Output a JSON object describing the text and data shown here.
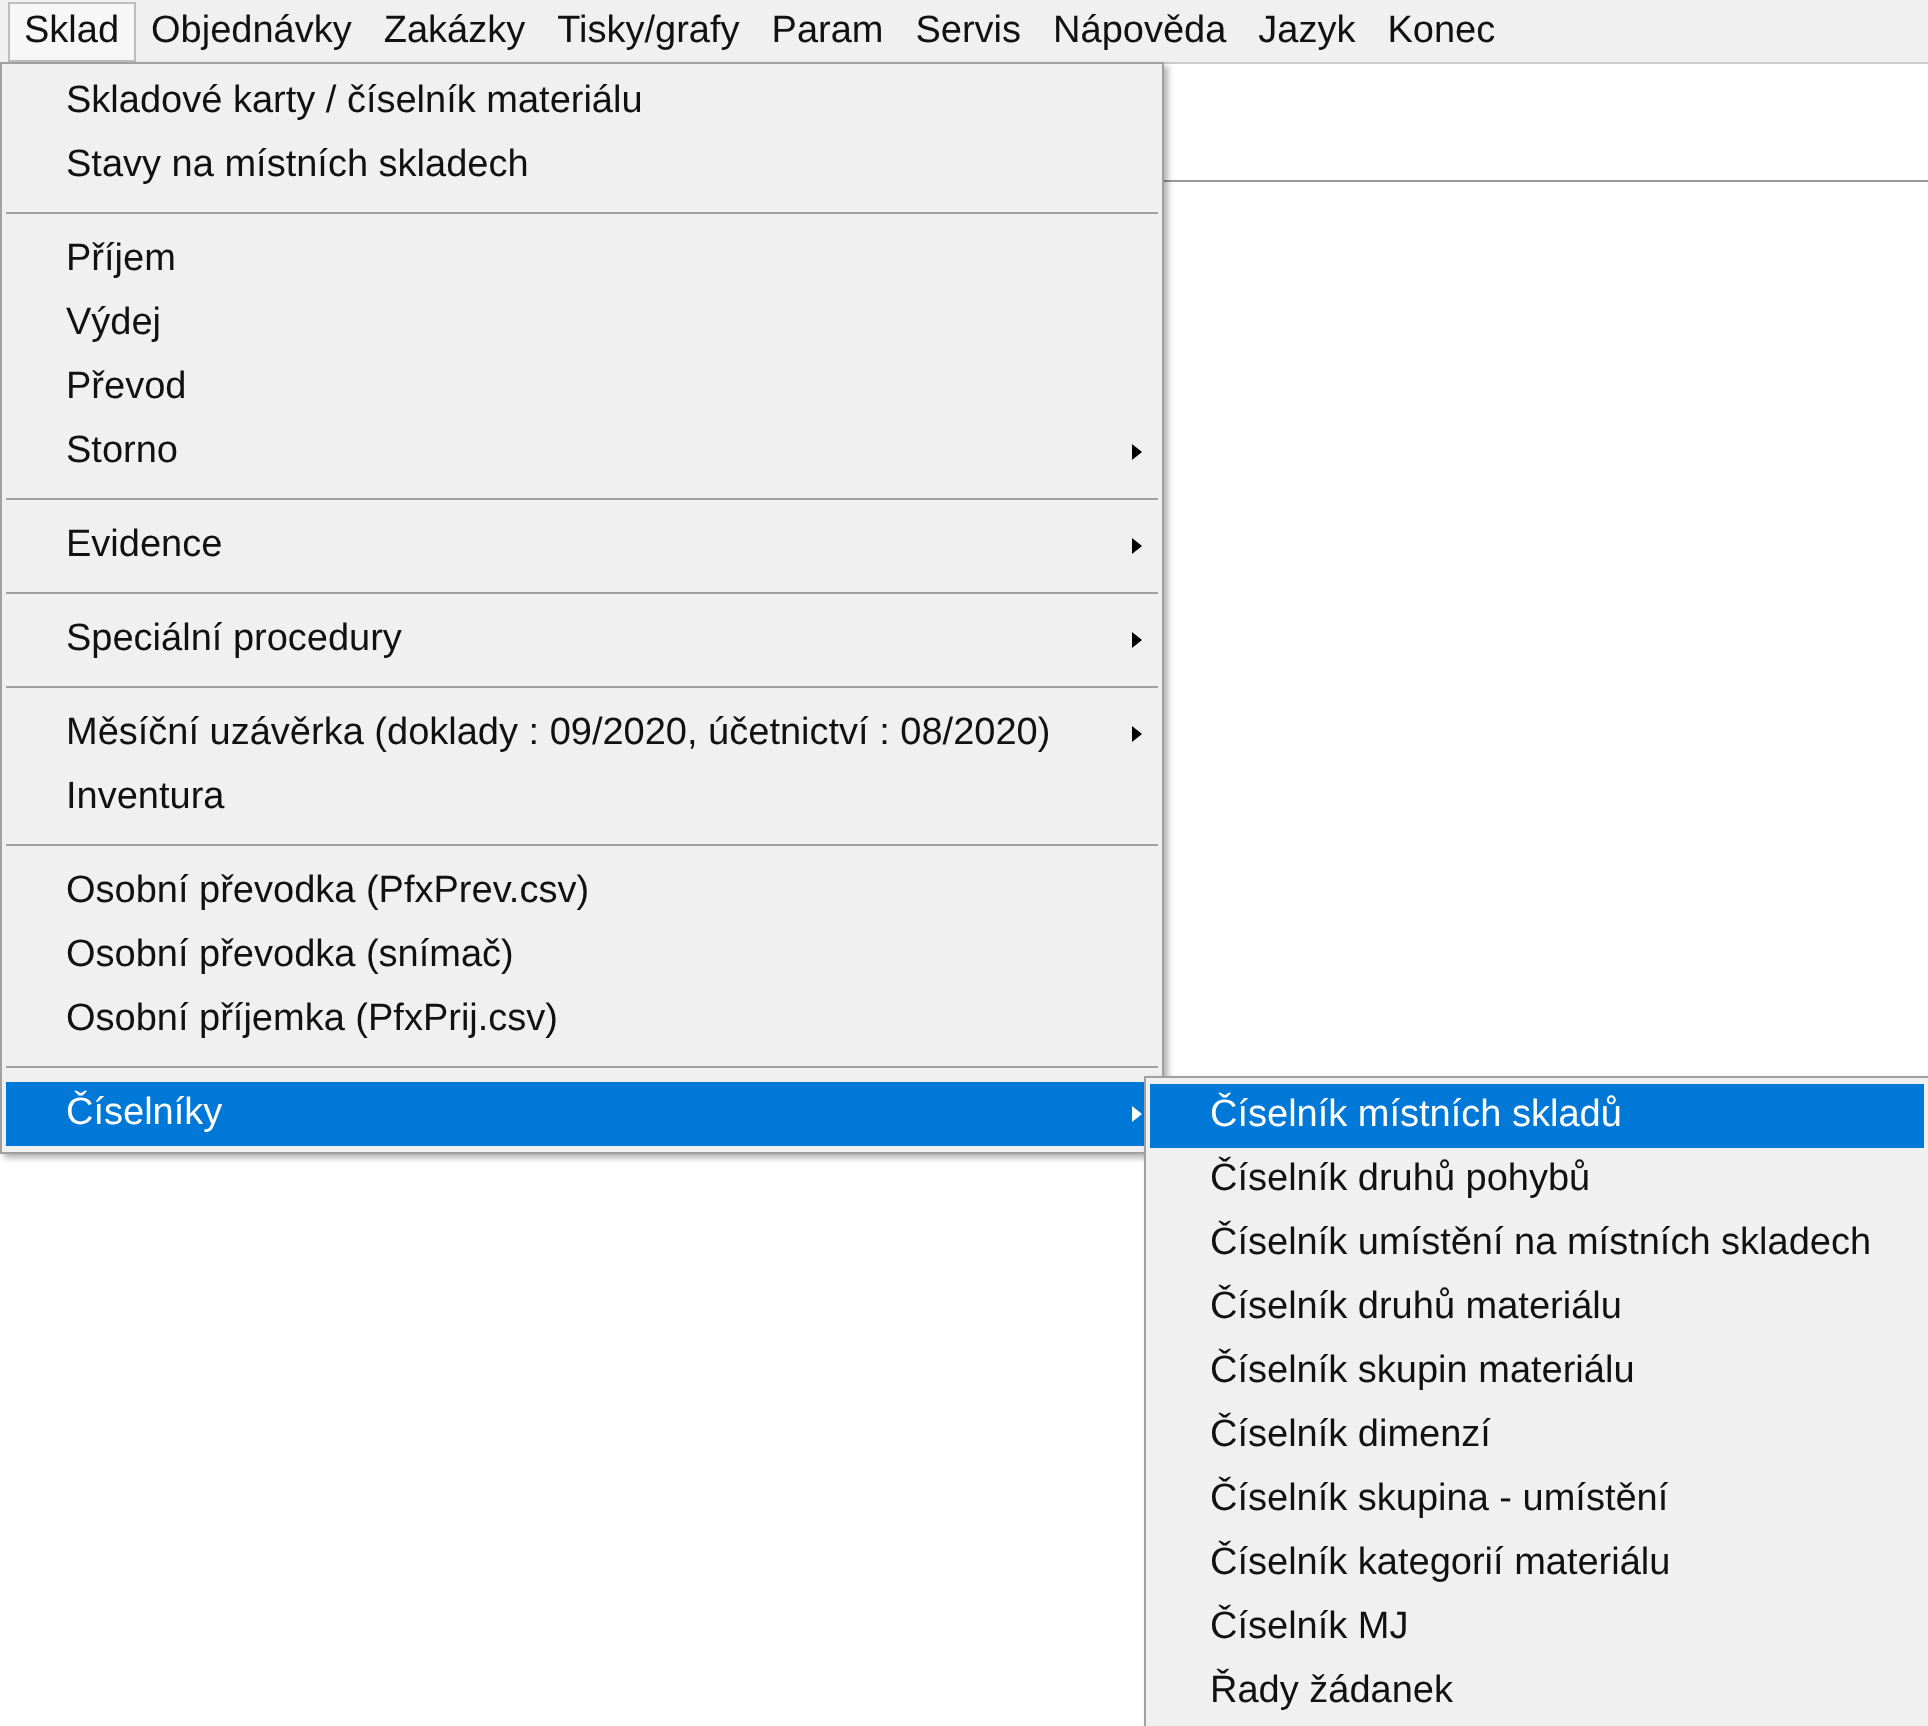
{
  "menubar": [
    {
      "label": "Sklad",
      "selected": true
    },
    {
      "label": "Objednávky",
      "selected": false
    },
    {
      "label": "Zakázky",
      "selected": false
    },
    {
      "label": "Tisky/grafy",
      "selected": false
    },
    {
      "label": "Param",
      "selected": false
    },
    {
      "label": "Servis",
      "selected": false
    },
    {
      "label": "Nápověda",
      "selected": false
    },
    {
      "label": "Jazyk",
      "selected": false
    },
    {
      "label": "Konec",
      "selected": false
    }
  ],
  "menu": [
    {
      "kind": "item",
      "label": "Skladové karty / číselník materiálu",
      "submenu": false,
      "selected": false
    },
    {
      "kind": "item",
      "label": "Stavy na místních skladech",
      "submenu": false,
      "selected": false
    },
    {
      "kind": "separator"
    },
    {
      "kind": "item",
      "label": "Příjem",
      "submenu": false,
      "selected": false
    },
    {
      "kind": "item",
      "label": "Výdej",
      "submenu": false,
      "selected": false
    },
    {
      "kind": "item",
      "label": "Převod",
      "submenu": false,
      "selected": false
    },
    {
      "kind": "item",
      "label": "Storno",
      "submenu": true,
      "selected": false
    },
    {
      "kind": "separator"
    },
    {
      "kind": "item",
      "label": "Evidence",
      "submenu": true,
      "selected": false
    },
    {
      "kind": "separator"
    },
    {
      "kind": "item",
      "label": "Speciální procedury",
      "submenu": true,
      "selected": false
    },
    {
      "kind": "separator"
    },
    {
      "kind": "item",
      "label": "Měsíční uzávěrka (doklady : 09/2020, účetnictví : 08/2020)",
      "submenu": true,
      "selected": false
    },
    {
      "kind": "item",
      "label": "Inventura",
      "submenu": false,
      "selected": false
    },
    {
      "kind": "separator"
    },
    {
      "kind": "item",
      "label": "Osobní převodka (PfxPrev.csv)",
      "submenu": false,
      "selected": false
    },
    {
      "kind": "item",
      "label": "Osobní převodka (snímač)",
      "submenu": false,
      "selected": false
    },
    {
      "kind": "item",
      "label": "Osobní příjemka (PfxPrij.csv)",
      "submenu": false,
      "selected": false
    },
    {
      "kind": "separator"
    },
    {
      "kind": "item",
      "label": "Číselníky",
      "submenu": true,
      "selected": true
    }
  ],
  "submenu": [
    {
      "label": "Číselník místních skladů",
      "selected": true
    },
    {
      "label": "Číselník druhů pohybů",
      "selected": false
    },
    {
      "label": "Číselník umístění na místních skladech",
      "selected": false
    },
    {
      "label": "Číselník druhů materiálu",
      "selected": false
    },
    {
      "label": "Číselník skupin materiálu",
      "selected": false
    },
    {
      "label": "Číselník dimenzí",
      "selected": false
    },
    {
      "label": "Číselník skupina - umístění",
      "selected": false
    },
    {
      "label": "Číselník kategorií materiálu",
      "selected": false
    },
    {
      "label": "Číselník MJ",
      "selected": false
    },
    {
      "label": "Řady žádanek",
      "selected": false
    }
  ]
}
